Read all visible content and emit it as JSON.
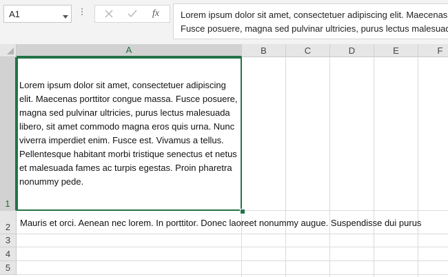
{
  "formula_bar": {
    "name_box": "A1",
    "formula": "Lorem ipsum dolor sit amet, consectetuer adipiscing elit. Maecenas porttitor congue massa. Fusce posuere, magna sed pulvinar ultricies, purus lectus malesuada libero, sit amet commodo magna eros quis urna. Nunc viverra imperdiet enim.",
    "fx_label": "fx",
    "icons": [
      "chevron-down-icon",
      "more-options-icon",
      "cancel-icon",
      "enter-icon",
      "function-icon"
    ]
  },
  "sheet": {
    "columns": [
      "A",
      "B",
      "C",
      "D",
      "E",
      "F"
    ],
    "rows": [
      "1",
      "2",
      "3",
      "4",
      "5"
    ],
    "selected_cell": "A1",
    "cells": {
      "A1": "Lorem ipsum dolor sit amet, consectetuer adipiscing elit. Maecenas porttitor congue massa. Fusce posuere, magna sed pulvinar ultricies, purus lectus malesuada libero, sit amet commodo magna eros quis urna. Nunc viverra imperdiet enim. Fusce est. Vivamus a tellus. Pellentesque habitant morbi tristique senectus et netus et malesuada fames ac turpis egestas. Proin pharetra nonummy pede.",
      "A2": "Mauris et orci. Aenean nec lorem. In porttitor. Donec laoreet nonummy augue. Suspendisse dui purus"
    }
  },
  "colors": {
    "accent": "#217346",
    "header_bg": "#e6e6e6",
    "gridline": "#dadada"
  }
}
